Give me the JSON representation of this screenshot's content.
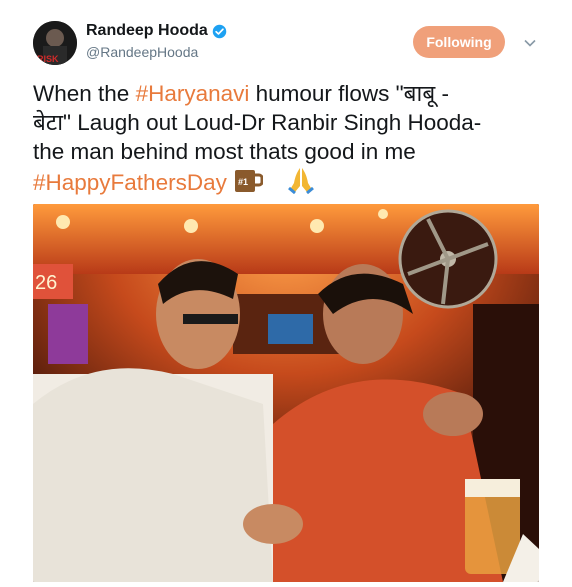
{
  "user": {
    "name": "Randeep Hooda",
    "handle": "@RandeepHooda",
    "avatar_label": "RISK"
  },
  "follow_button": {
    "label": "Following"
  },
  "tweet": {
    "line1_a": "When the ",
    "line1_hashtag": "#Haryanavi",
    "line1_b": " humour flows \"बाबू -",
    "line2": "बेटा\" Laugh out Loud-Dr Ranbir Singh Hooda-",
    "line3": "the man behind most thats good in me",
    "line4_hashtag": "#HappyFathersDay",
    "mug_text": "#1"
  },
  "photo": {
    "sign_text": "26"
  },
  "icons": [
    "verified-badge-icon",
    "chevron-down-icon",
    "number-one-mug-emoji",
    "folded-hands-emoji"
  ],
  "colors": {
    "accent": "#e87a3c",
    "follow_button": "#f0a07a",
    "verified": "#1da1f2"
  }
}
